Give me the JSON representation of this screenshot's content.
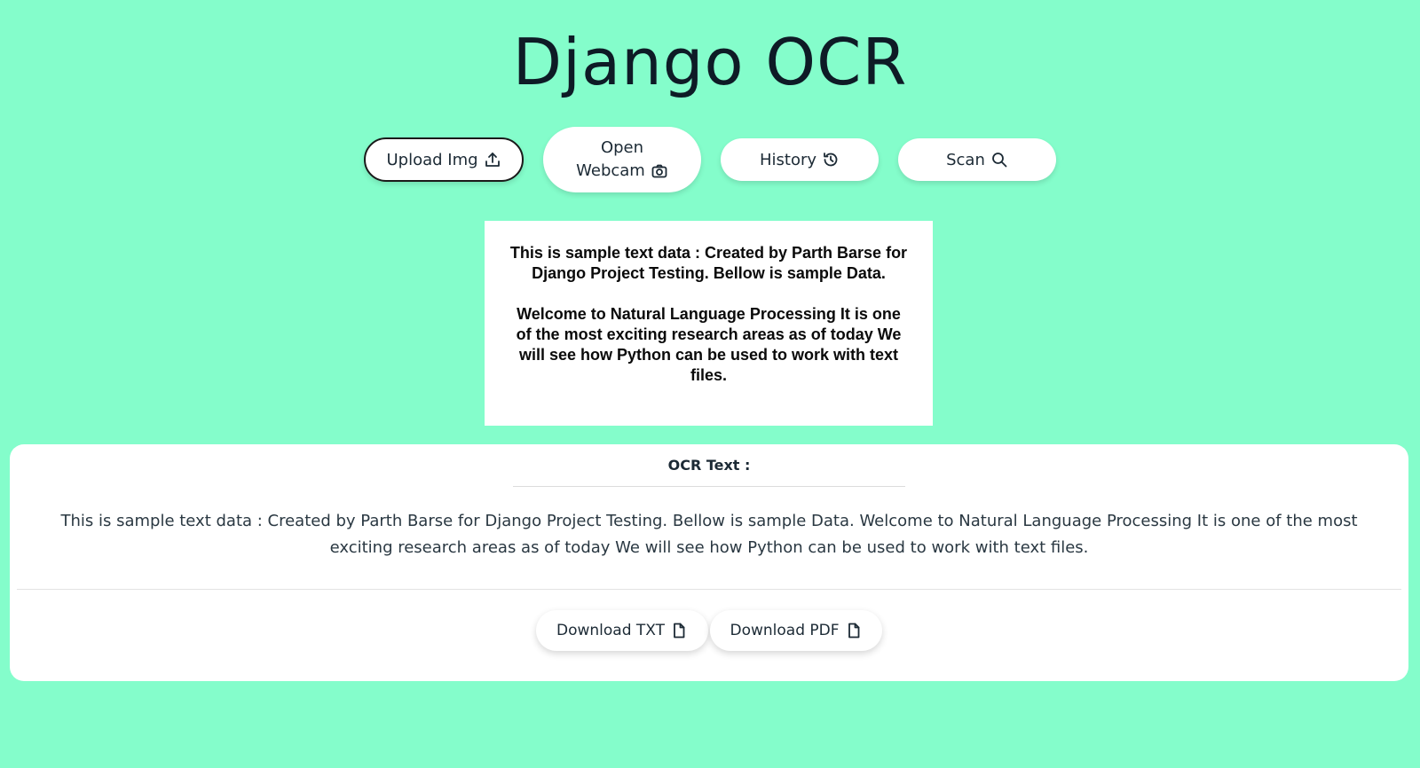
{
  "app": {
    "title": "Django OCR"
  },
  "toolbar": {
    "upload_label": "Upload Img",
    "webcam_line1": "Open",
    "webcam_line2": "Webcam",
    "history_label": "History",
    "scan_label": "Scan"
  },
  "icons": {
    "upload": "upload-icon",
    "camera": "camera-icon",
    "history": "history-icon",
    "search": "search-icon",
    "file": "file-icon"
  },
  "preview": {
    "paragraph1": "This is sample text data : Created by Parth Barse for Django Project Testing. Bellow is sample Data.",
    "paragraph2": "Welcome to Natural Language Processing It is one of the most exciting research areas as of today We will see how Python can be used to work with text files."
  },
  "result": {
    "label": "OCR Text :",
    "text": "This is sample text data : Created by Parth Barse for Django Project Testing. Bellow is sample Data. Welcome to Natural Language Processing It is one of the most exciting research areas as of today We will see how Python can be used to work with text files.",
    "download_txt_label": "Download TXT",
    "download_pdf_label": "Download PDF"
  },
  "colors": {
    "background": "#84fdcb",
    "card": "#ffffff",
    "text": "#0e1b26"
  }
}
